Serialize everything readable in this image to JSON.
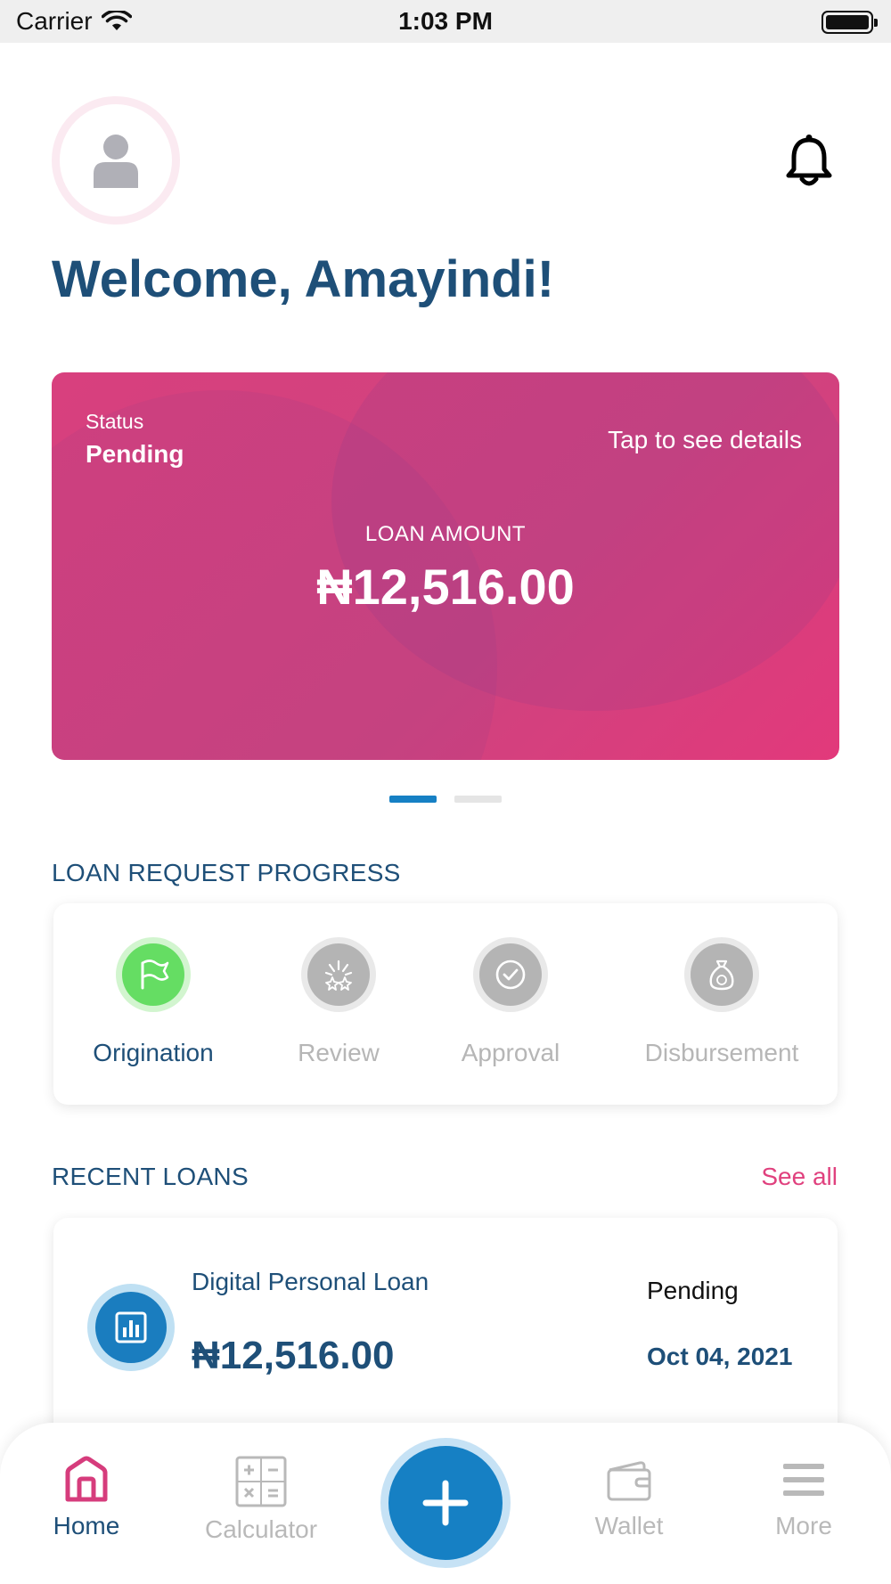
{
  "status_bar": {
    "carrier": "Carrier",
    "time": "1:03 PM",
    "icons": [
      "wifi-icon",
      "battery-icon"
    ]
  },
  "header": {
    "avatar_icon": "user-avatar-icon",
    "notification_icon": "bell-icon",
    "welcome": "Welcome, Amayindi!"
  },
  "loan_card": {
    "status_label": "Status",
    "status_value": "Pending",
    "tap_hint": "Tap to see details",
    "amount_label": "LOAN AMOUNT",
    "amount": "₦12,516.00",
    "pager": {
      "pages": 2,
      "active_index": 0
    }
  },
  "progress": {
    "title": "LOAN REQUEST PROGRESS",
    "steps": [
      {
        "label": "Origination",
        "icon": "flag-icon",
        "state": "done"
      },
      {
        "label": "Review",
        "icon": "sparkle-review-icon",
        "state": "pending"
      },
      {
        "label": "Approval",
        "icon": "check-circle-icon",
        "state": "pending"
      },
      {
        "label": "Disbursement",
        "icon": "money-bag-icon",
        "state": "pending"
      }
    ]
  },
  "recent_loans": {
    "title": "RECENT LOANS",
    "see_all": "See all",
    "items": [
      {
        "icon": "bar-chart-icon",
        "name": "Digital Personal Loan",
        "amount": "₦12,516.00",
        "status": "Pending",
        "date": "Oct 04, 2021"
      }
    ]
  },
  "tab_bar": {
    "tabs": [
      {
        "label": "Home",
        "icon": "home-icon",
        "active": true
      },
      {
        "label": "Calculator",
        "icon": "calculator-icon",
        "active": false
      },
      {
        "label": "Wallet",
        "icon": "wallet-icon",
        "active": false
      },
      {
        "label": "More",
        "icon": "menu-icon",
        "active": false
      }
    ],
    "fab_icon": "plus-icon"
  },
  "colors": {
    "brand_pink": "#d8407e",
    "brand_blue": "#1680c4",
    "text_navy": "#1e4f78",
    "success_green": "#65dd63",
    "inactive_gray": "#b4b4b4"
  }
}
